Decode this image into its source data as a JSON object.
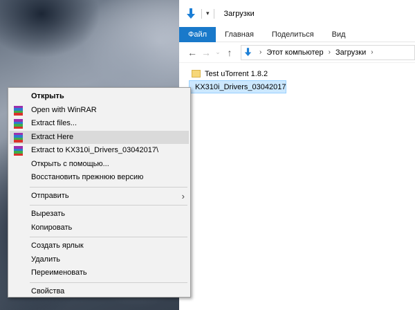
{
  "explorer": {
    "title": "Загрузки",
    "ribbon_tabs": [
      "Файл",
      "Главная",
      "Поделиться",
      "Вид"
    ],
    "address": {
      "crumbs": [
        "Этот компьютер",
        "Загрузки"
      ]
    },
    "files": [
      {
        "name": "Test uTorrent 1.8.2",
        "type": "folder"
      },
      {
        "name": "KX310i_Drivers_03042017",
        "type": "rar-archive",
        "selected": true
      }
    ]
  },
  "context_menu": {
    "items": [
      {
        "label": "Открыть",
        "bold": true
      },
      {
        "label": "Open with WinRAR",
        "icon": "winrar-icon"
      },
      {
        "label": "Extract files...",
        "icon": "winrar-icon"
      },
      {
        "label": "Extract Here",
        "icon": "winrar-icon",
        "hover": true
      },
      {
        "label": "Extract to KX310i_Drivers_03042017\\",
        "icon": "winrar-icon"
      },
      {
        "label": "Открыть с помощью..."
      },
      {
        "label": "Восстановить прежнюю версию"
      },
      {
        "label": "Отправить",
        "submenu": true
      },
      {
        "label": "Вырезать"
      },
      {
        "label": "Копировать"
      },
      {
        "label": "Создать ярлык"
      },
      {
        "label": "Удалить"
      },
      {
        "label": "Переименовать"
      },
      {
        "label": "Свойства"
      }
    ]
  }
}
